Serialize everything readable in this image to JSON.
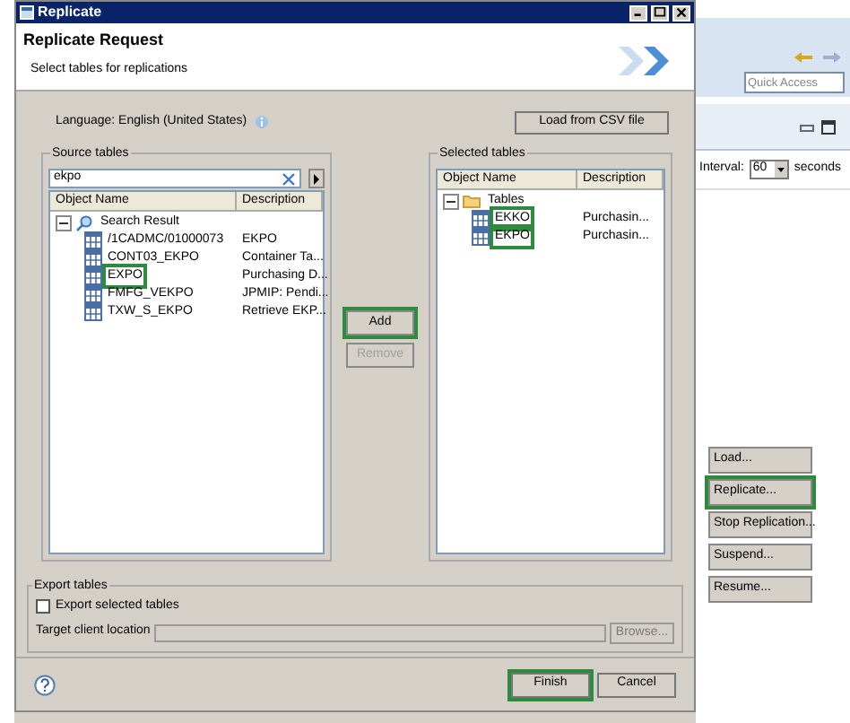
{
  "background_app": {
    "quick_access_placeholder": "Quick Access",
    "interval_label": "Interval:",
    "interval_value": "60",
    "seconds_label": "seconds",
    "buttons": [
      {
        "label": "Load...",
        "highlighted": false
      },
      {
        "label": "Replicate...",
        "highlighted": true
      },
      {
        "label": "Stop Replication...",
        "highlighted": false
      },
      {
        "label": "Suspend...",
        "highlighted": false
      },
      {
        "label": "Resume...",
        "highlighted": false
      }
    ]
  },
  "dialog": {
    "title": "Replicate",
    "header_title": "Replicate Request",
    "header_subtitle": "Select tables for replications",
    "language": "Language: English (United States)",
    "load_csv_button": "Load from CSV file",
    "source_tables": {
      "label": "Source tables",
      "search_value": "ekpo",
      "columns": [
        "Object Name",
        "Description"
      ],
      "tree": {
        "label": "Search Result",
        "expanded": true,
        "children": [
          {
            "name": "/1CADMC/01000073",
            "description": "EKPO",
            "highlighted": false
          },
          {
            "name": "CONT03_EKPO",
            "description": "Container Ta...",
            "highlighted": false
          },
          {
            "name": "EXPO",
            "description": "Purchasing D...",
            "highlighted": true
          },
          {
            "name": "FMFG_VEKPO",
            "description": "JPMIP: Pendi...",
            "highlighted": false
          },
          {
            "name": "TXW_S_EKPO",
            "description": "Retrieve EKP...",
            "highlighted": false
          }
        ]
      }
    },
    "add_button": {
      "label": "Add",
      "highlighted": true,
      "disabled": false
    },
    "remove_button": {
      "label": "Remove",
      "highlighted": false,
      "disabled": true
    },
    "selected_tables": {
      "label": "Selected tables",
      "columns": [
        "Object Name",
        "Description"
      ],
      "tree": {
        "label": "Tables",
        "expanded": true,
        "children": [
          {
            "name": "EKKO",
            "description": "Purchasin...",
            "highlighted": true
          },
          {
            "name": "EKPO",
            "description": "Purchasin...",
            "highlighted": true
          }
        ]
      }
    },
    "export": {
      "label": "Export tables",
      "checkbox": {
        "label": "Export selected tables",
        "checked": false
      },
      "target_label": "Target client location",
      "browse_button": {
        "label": "Browse...",
        "disabled": true
      }
    },
    "buttons": [
      {
        "label": "Finish",
        "highlighted": true
      },
      {
        "label": "Cancel",
        "highlighted": false
      }
    ]
  }
}
